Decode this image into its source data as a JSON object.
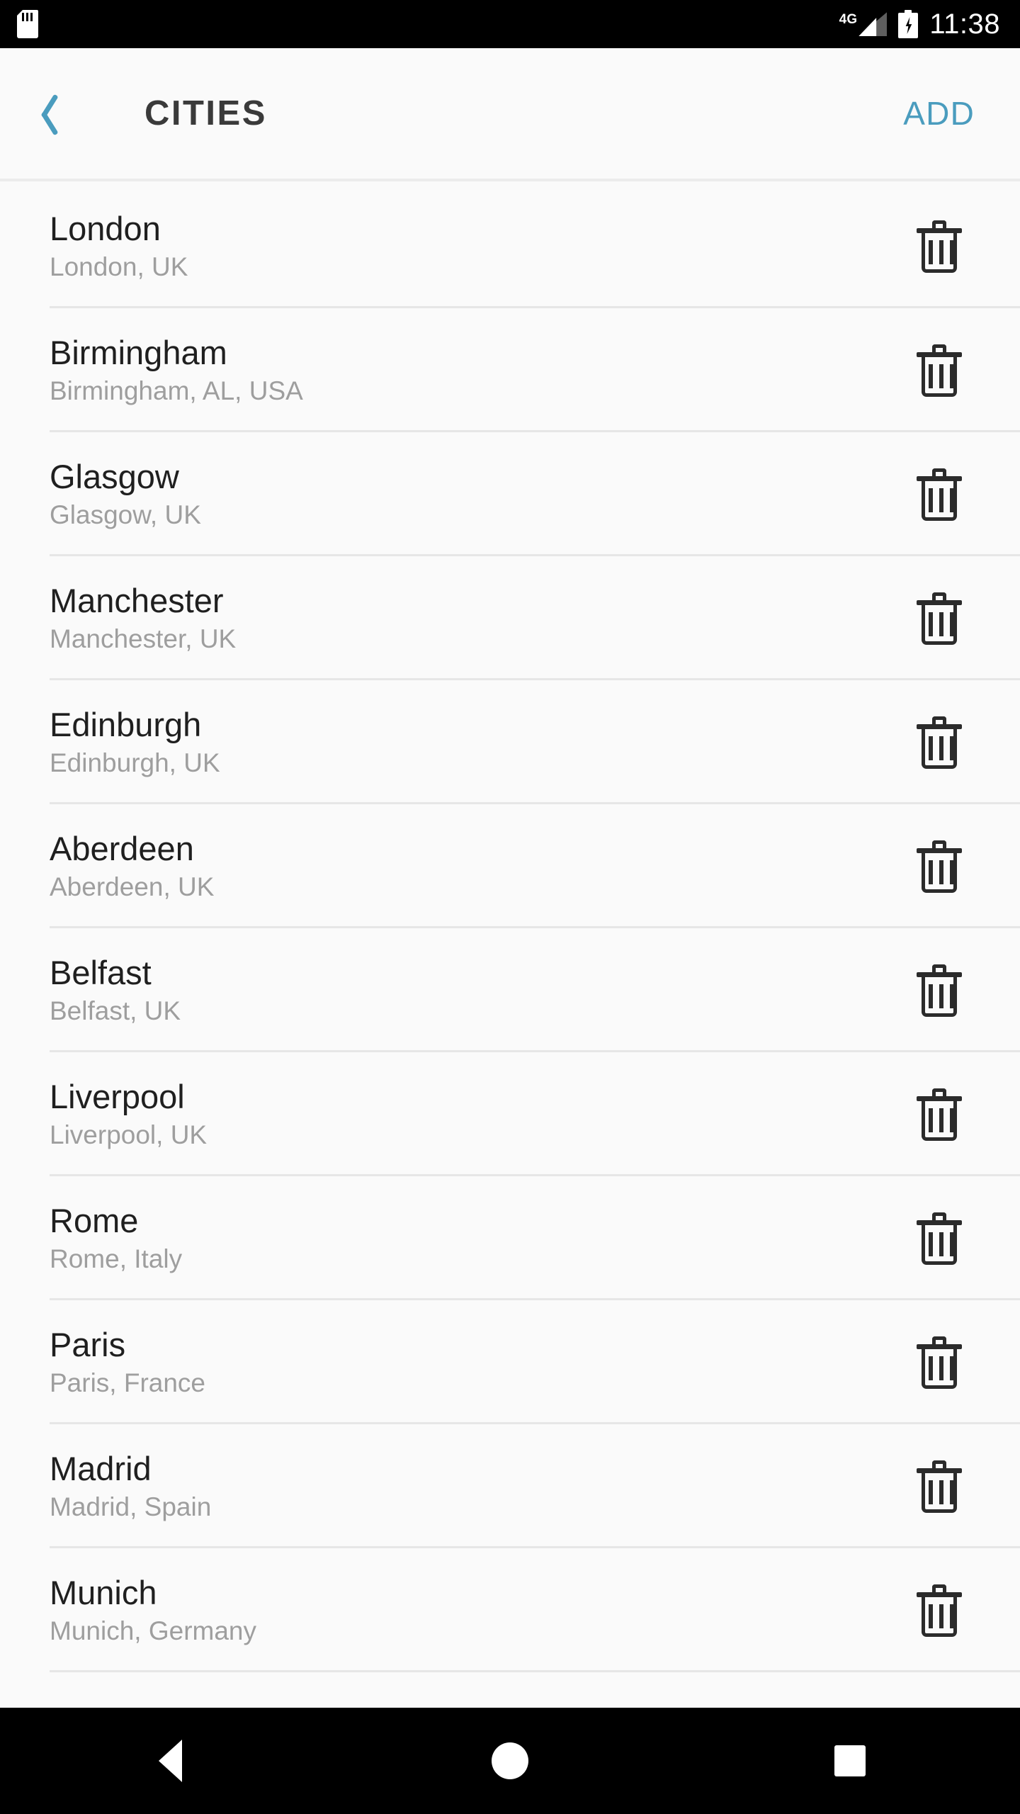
{
  "status_bar": {
    "sd_card_icon": "sd-card-icon",
    "network_label": "4G",
    "signal_icon": "signal-bars-icon",
    "battery_icon": "battery-charging-icon",
    "time": "11:38"
  },
  "header": {
    "back_icon": "back-chevron-icon",
    "title": "CITIES",
    "add_label": "ADD",
    "accent_color": "#4A9CBE",
    "title_color": "#3A3A3A"
  },
  "list": {
    "delete_icon": "trash-icon",
    "items": [
      {
        "name": "London",
        "subtitle": "London, UK"
      },
      {
        "name": "Birmingham",
        "subtitle": "Birmingham, AL, USA"
      },
      {
        "name": "Glasgow",
        "subtitle": "Glasgow, UK"
      },
      {
        "name": "Manchester",
        "subtitle": "Manchester, UK"
      },
      {
        "name": "Edinburgh",
        "subtitle": "Edinburgh, UK"
      },
      {
        "name": "Aberdeen",
        "subtitle": "Aberdeen, UK"
      },
      {
        "name": "Belfast",
        "subtitle": "Belfast, UK"
      },
      {
        "name": "Liverpool",
        "subtitle": "Liverpool, UK"
      },
      {
        "name": "Rome",
        "subtitle": "Rome, Italy"
      },
      {
        "name": "Paris",
        "subtitle": "Paris, France"
      },
      {
        "name": "Madrid",
        "subtitle": "Madrid, Spain"
      },
      {
        "name": "Munich",
        "subtitle": "Munich, Germany"
      }
    ]
  },
  "nav_bar": {
    "back_icon": "nav-back-triangle-icon",
    "home_icon": "nav-home-circle-icon",
    "recents_icon": "nav-recents-square-icon"
  },
  "colors": {
    "background": "#FAFAFA",
    "primary_text": "#1F1F1F",
    "secondary_text": "#9E9E9E",
    "divider": "#E6E6E6",
    "system_bar": "#000000"
  }
}
